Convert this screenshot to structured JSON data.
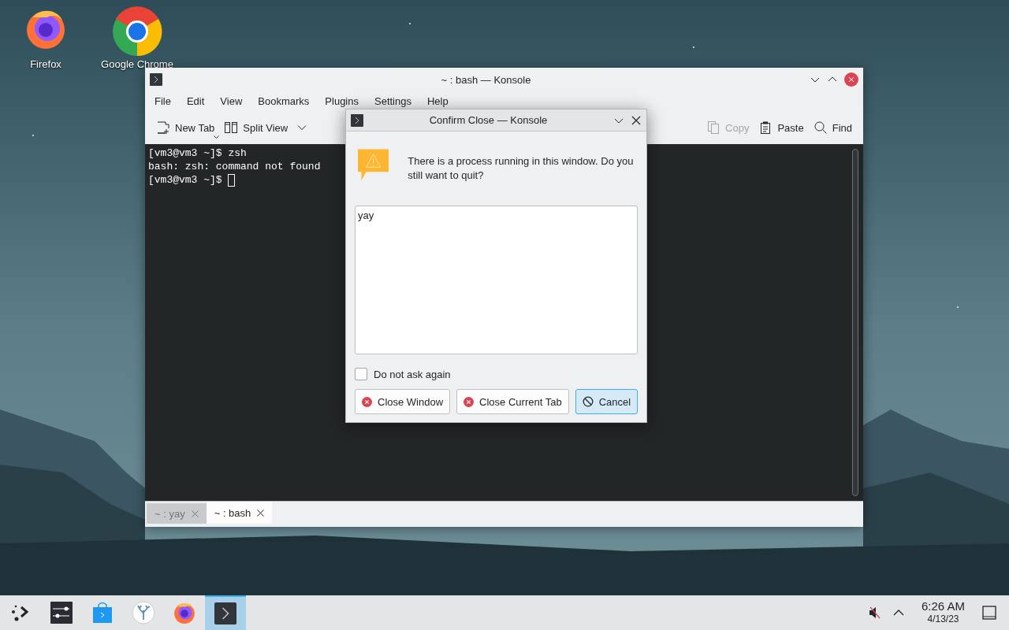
{
  "desktop_icons": [
    {
      "label": "Firefox",
      "kind": "firefox"
    },
    {
      "label": "Google Chrome",
      "kind": "chrome"
    }
  ],
  "konsole": {
    "title": "~ : bash — Konsole",
    "menu": [
      "File",
      "Edit",
      "View",
      "Bookmarks",
      "Plugins",
      "Settings",
      "Help"
    ],
    "toolbar_left": [
      {
        "label": "New Tab",
        "kind": "new-tab",
        "disabled": false,
        "dropdown": true
      },
      {
        "label": "Split View",
        "kind": "split-view",
        "disabled": false,
        "dropdown": true
      }
    ],
    "toolbar_right": [
      {
        "label": "Copy",
        "kind": "copy",
        "disabled": true,
        "dropdown": false
      },
      {
        "label": "Paste",
        "kind": "paste",
        "disabled": false,
        "dropdown": false
      },
      {
        "label": "Find",
        "kind": "find",
        "disabled": false,
        "dropdown": false
      }
    ],
    "terminal_lines": [
      "[vm3@vm3 ~]$ zsh",
      "bash: zsh: command not found",
      "[vm3@vm3 ~]$ "
    ],
    "tabs": [
      {
        "label": "~ : yay",
        "selected": false
      },
      {
        "label": "~ : bash",
        "selected": true
      }
    ]
  },
  "dialog": {
    "title": "Confirm Close — Konsole",
    "message": "There is a process running in this window. Do you still want to quit?",
    "process_list": "yay",
    "checkbox": {
      "label": "Do not ask again",
      "checked": false
    },
    "buttons": [
      {
        "label": "Close Window",
        "kind": "close",
        "default": false
      },
      {
        "label": "Close Current Tab",
        "kind": "close",
        "default": false
      },
      {
        "label": "Cancel",
        "kind": "cancel",
        "default": true
      }
    ]
  },
  "taskbar": {
    "items": [
      {
        "kind": "launcher",
        "active": false
      },
      {
        "kind": "settings",
        "active": false
      },
      {
        "kind": "store",
        "active": false
      },
      {
        "kind": "coral",
        "active": false
      },
      {
        "kind": "firefox",
        "active": false
      },
      {
        "kind": "terminal",
        "active": true
      }
    ],
    "clock": {
      "time": "6:26 AM",
      "date": "4/13/23"
    }
  }
}
